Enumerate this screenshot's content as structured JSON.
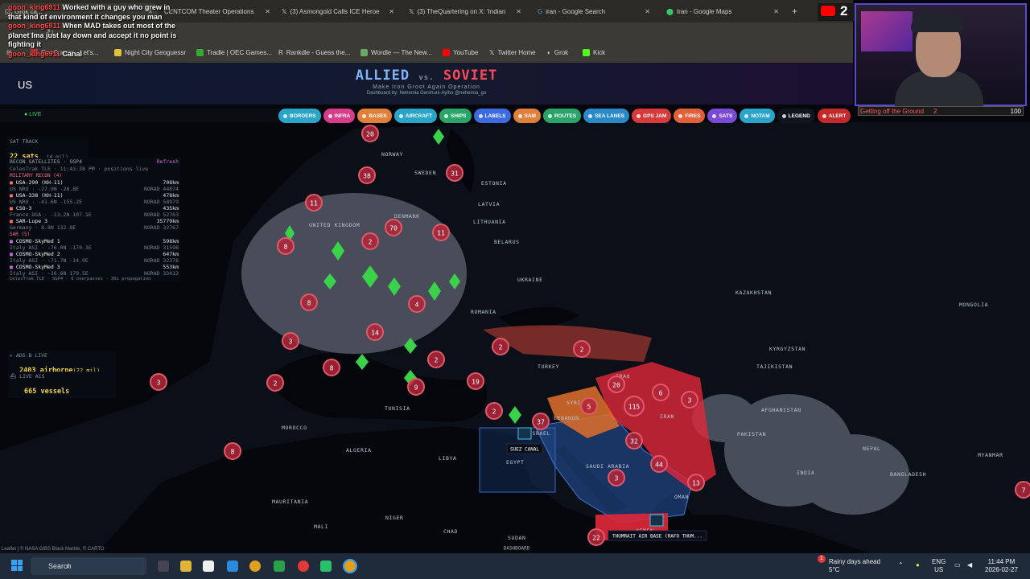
{
  "tabs": [
    {
      "label": "(3) Grok ca..."
    },
    {
      "label": "CENTCOM Theater Operations"
    },
    {
      "label": "(3) Asmongold Calls ICE Heroe"
    },
    {
      "label": "(3) TheQuartering on X: 'Indian"
    },
    {
      "label": "iran - Google Search"
    },
    {
      "label": "Iran - Google Maps"
    }
  ],
  "bookmarks": [
    {
      "label": "GeoGuessr - Let's..."
    },
    {
      "label": "Night City Geoguessr"
    },
    {
      "label": "Tradle | OEC Games..."
    },
    {
      "label": "Rankdle - Guess the..."
    },
    {
      "label": "Wordle — The New..."
    },
    {
      "label": "YouTube"
    },
    {
      "label": "Twitter Home"
    },
    {
      "label": "Grok"
    },
    {
      "label": "Kick"
    }
  ],
  "chat": [
    {
      "user": "goon_king6911",
      "text": "Worked with a guy who grew in that kind of environment it changes you man"
    },
    {
      "user": "goon_king6911",
      "text": "When MAD takes out most of the planet Ima just lay down and accept it no point is fighting it"
    },
    {
      "user": "goon_king6911",
      "text": "Canal"
    }
  ],
  "country_tag": "US",
  "brand": {
    "allied": "ALLIED",
    "vs": "vs.",
    "soviet": "SOVIET",
    "subtitle": "Make Iron Groot Again Operation",
    "credit": "Dashboard by: Nehemia Gershuni-Aylho @nehemia_go"
  },
  "stream": {
    "yt_count": "2",
    "goal_label": "Getting off the Ground",
    "goal_current": "2",
    "goal_target": "100",
    "goal_fraction": 0.02
  },
  "live_label": "LIVE",
  "toolbar": [
    {
      "label": "BORDERS",
      "color": "#2aa5c9"
    },
    {
      "label": "INFRA",
      "color": "#d63d8a"
    },
    {
      "label": "BASES",
      "color": "#e0803a"
    },
    {
      "label": "AIRCRAFT",
      "color": "#2aa5c9"
    },
    {
      "label": "SHIPS",
      "color": "#2aa56a"
    },
    {
      "label": "LABELS",
      "color": "#3d6ae0"
    },
    {
      "label": "SAM",
      "color": "#e0803a"
    },
    {
      "label": "ROUTES",
      "color": "#2aa56a"
    },
    {
      "label": "SEA LANES",
      "color": "#2a8ac9"
    },
    {
      "label": "GPS JAM",
      "color": "#d63a3a"
    },
    {
      "label": "FIRES",
      "color": "#e0603a"
    },
    {
      "label": "SATS",
      "color": "#7a4ad6"
    },
    {
      "label": "NOTAM",
      "color": "#2aa5c9"
    },
    {
      "label": "LEGEND",
      "color": "#10141c"
    },
    {
      "label": "ALERT",
      "color": "#c42a2a"
    }
  ],
  "sat_track": {
    "title": "SAT TRACK",
    "count": "22 sats",
    "mil": "(4 mil)"
  },
  "recon": {
    "title": "RECON SATELLITES · SGP4",
    "refresh": "Refresh",
    "subtitle": "CelesTrak TLE · 11:43:38 PM · positions live",
    "mil_header": "MILITARY RECON (4)",
    "sar_header": "SAR (5)",
    "items": [
      {
        "name": "USA-290 (KH-11)",
        "alt": "708km",
        "sub": "US NRO · -27.9N -28.8E",
        "norad": "NORAD 44874"
      },
      {
        "name": "USA-338 (KH-11)",
        "alt": "478km",
        "sub": "US NRO · -41.6N -155.2E",
        "norad": "NORAD 58979"
      },
      {
        "name": "CSO-3",
        "alt": "435km",
        "sub": "France DGA · -13.2N 107.1E",
        "norad": "NORAD 52763"
      },
      {
        "name": "SAR-Lupe 3",
        "alt": "35779km",
        "sub": "Germany · 8.8N 132.8E",
        "norad": "NORAD 32767"
      },
      {
        "name": "COSMO-SkyMed 1",
        "alt": "598km",
        "sub": "Italy ASI · -76.0N -170.3E",
        "norad": "NORAD 31598"
      },
      {
        "name": "COSMO-SkyMed 2",
        "alt": "647km",
        "sub": "Italy ASI · -71.7N -14.9E",
        "norad": "NORAD 32376"
      },
      {
        "name": "COSMO-SkyMed 3",
        "alt": "553km",
        "sub": "Italy ASI · -16.6N 179.5E",
        "norad": "NORAD 33412"
      }
    ],
    "footer": "CelesTrak TLE · SGP4 · 0 overpasses · 30s propagation"
  },
  "adsb": {
    "title": "ADS-B LIVE",
    "count": "2403 airborne",
    "mil": "(22 mil)"
  },
  "ais": {
    "title": "LIVE AIS",
    "count": "665 vessels"
  },
  "map": {
    "attribution": "Leaflet | © NASA GIBS Black Marble, © CARTO",
    "dashboard_btn": "DASHBOARD",
    "suez_label": "SUEZ CANAL",
    "thumrait_label": "THUMRAIT AIR BASE (RAFO THUM...",
    "countries": [
      "NORWAY",
      "SWEDEN",
      "ESTONIA",
      "LATVIA",
      "LITHUANIA",
      "DENMARK",
      "BELARUS",
      "UKRAINE",
      "ROMANIA",
      "TURKEY",
      "SYRIA",
      "LEBANON",
      "IRAQ",
      "IRAN",
      "KAZAKHSTAN",
      "MONGOLIA",
      "KYRGYZSTAN",
      "TAJIKISTAN",
      "AFGHANISTAN",
      "PAKISTAN",
      "NEPAL",
      "MYANMAR",
      "INDIA",
      "BANGLADESH",
      "TUNISIA",
      "MOROCCO",
      "ALGERIA",
      "LIBYA",
      "EGYPT",
      "SAUDI ARABIA",
      "OMAN",
      "YEMEN",
      "MAURITANIA",
      "MALI",
      "NIGER",
      "CHAD",
      "SUDAN",
      "UNITED KINGDOM",
      "ISRAEL"
    ],
    "clusters": [
      "20",
      "38",
      "31",
      "11",
      "11",
      "70",
      "8",
      "8",
      "4",
      "3",
      "14",
      "8",
      "2",
      "2",
      "9",
      "2",
      "19",
      "2",
      "8",
      "3",
      "2",
      "37",
      "5",
      "20",
      "115",
      "6",
      "3",
      "32",
      "44",
      "3",
      "13",
      "22",
      "2",
      "7"
    ]
  },
  "taskbar": {
    "search": "Search",
    "weather_temp": "5°C",
    "weather_desc": "Rainy days ahead",
    "lang": "ENG",
    "region": "US",
    "time": "11:44 PM",
    "date": "2026-02-27",
    "notif": "1"
  }
}
